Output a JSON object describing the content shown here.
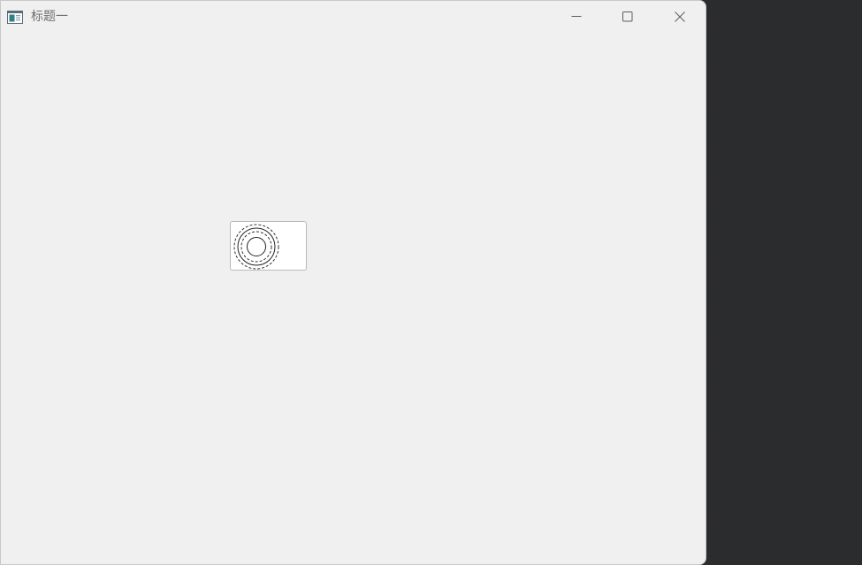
{
  "window": {
    "title": "标题一",
    "app_icon": "app-window-icon"
  },
  "controls": {
    "minimize_icon": "minimize-icon",
    "maximize_icon": "maximize-icon",
    "close_icon": "close-icon"
  },
  "content": {
    "button_icon": "concentric-circles-icon"
  },
  "colors": {
    "window_bg": "#f0f0f0",
    "desktop_bg": "#2b2c2e",
    "title_text": "#6e6e6e",
    "button_bg": "#ffffff",
    "button_border": "#b9b9b9"
  }
}
